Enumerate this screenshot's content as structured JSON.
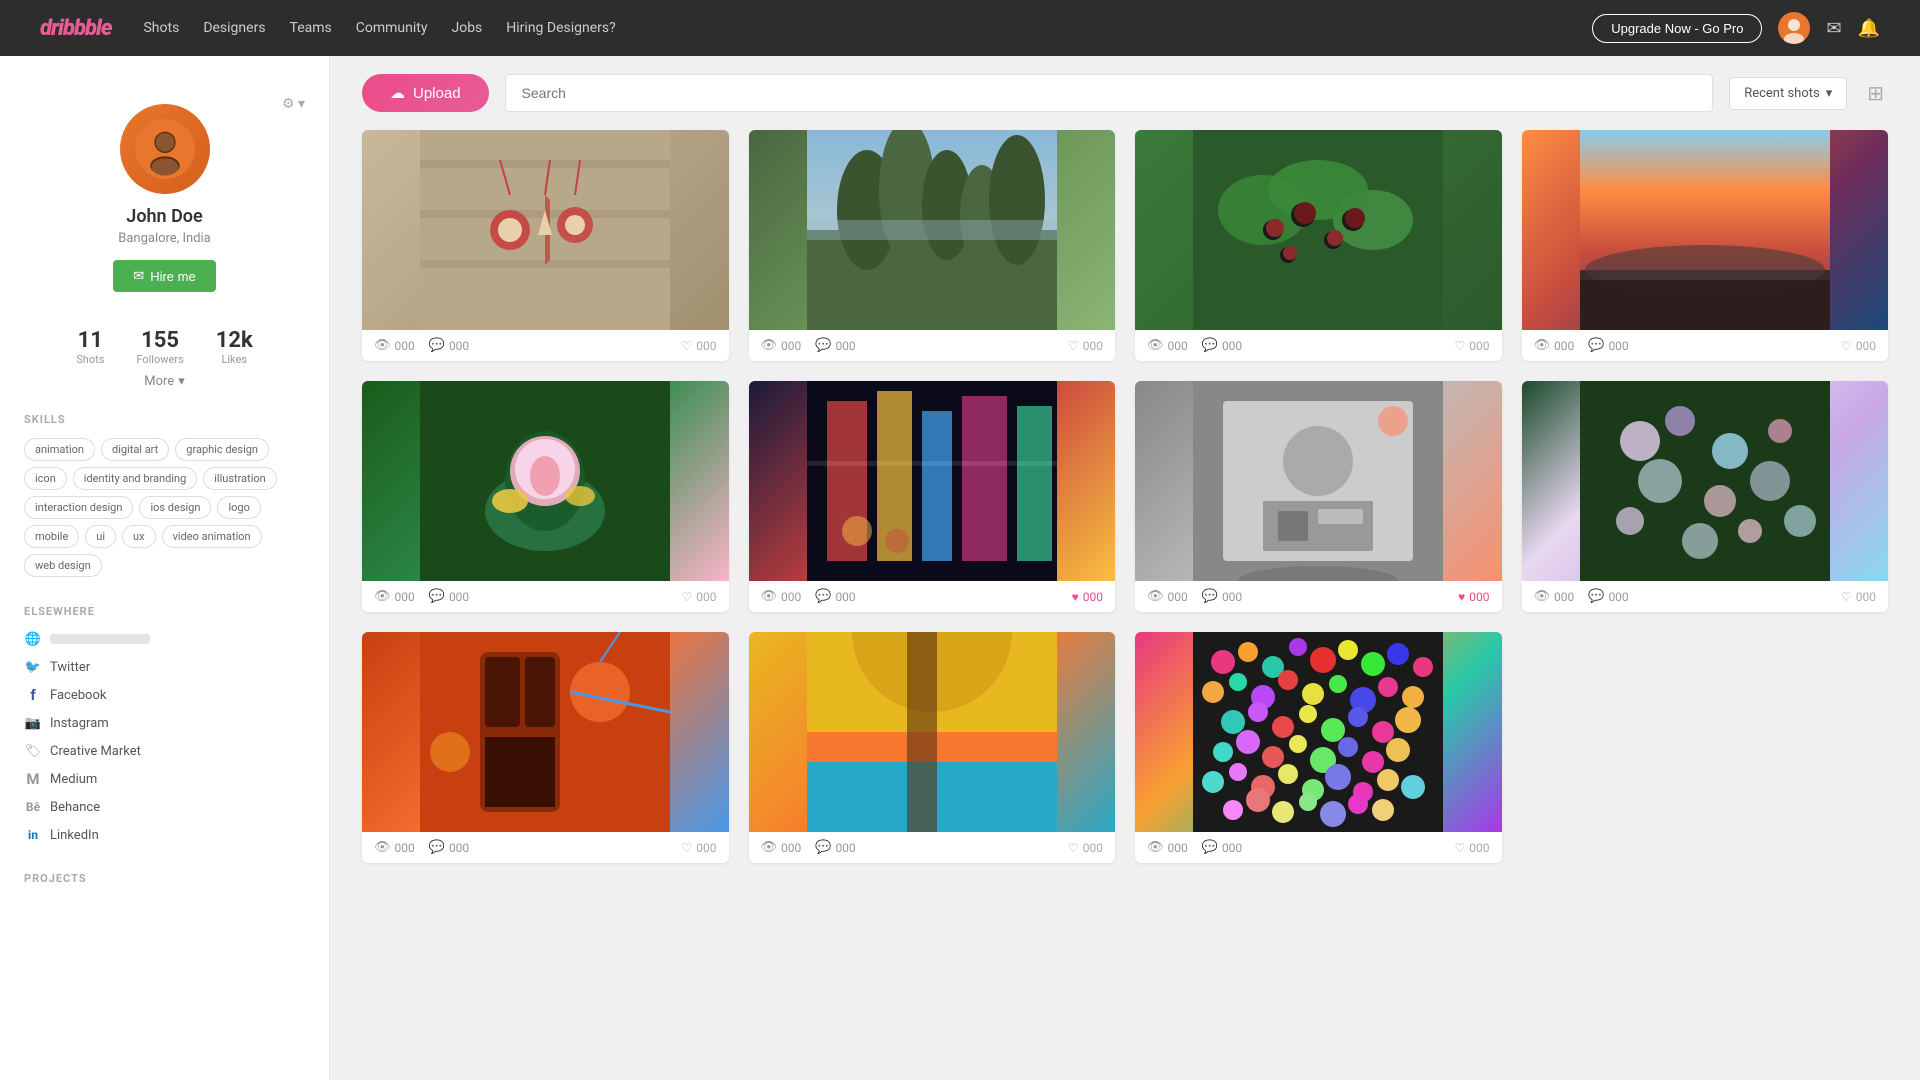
{
  "navbar": {
    "logo": "dribbble",
    "links": [
      {
        "label": "Shots",
        "id": "shots"
      },
      {
        "label": "Designers",
        "id": "designers"
      },
      {
        "label": "Teams",
        "id": "teams"
      },
      {
        "label": "Community",
        "id": "community"
      },
      {
        "label": "Jobs",
        "id": "jobs"
      },
      {
        "label": "Hiring Designers?",
        "id": "hiring"
      }
    ],
    "upgrade_button": "Upgrade Now - Go Pro",
    "mail_icon": "✉",
    "bell_icon": "🔔"
  },
  "toolbar": {
    "upload_label": "Upload",
    "search_placeholder": "Search",
    "recent_shots_label": "Recent shots",
    "grid_icon": "⊞"
  },
  "sidebar": {
    "profile": {
      "name": "John Doe",
      "location": "Bangalore, India",
      "hire_label": "Hire me"
    },
    "stats": {
      "shots_count": "11",
      "shots_label": "Shots",
      "followers_count": "155",
      "followers_label": "Followers",
      "likes_count": "12k",
      "likes_label": "Likes"
    },
    "more_label": "More",
    "skills_title": "SKILLS",
    "skills": [
      "animation",
      "digital art",
      "graphic design",
      "icon",
      "identity and branding",
      "illustration",
      "interaction design",
      "ios design",
      "logo",
      "mobile",
      "ui",
      "ux",
      "video animation",
      "web design"
    ],
    "elsewhere_title": "ELSEWHERE",
    "elsewhere_links": [
      {
        "label": "",
        "type": "url",
        "icon": "🌐"
      },
      {
        "label": "Twitter",
        "type": "twitter",
        "icon": "🐦"
      },
      {
        "label": "Facebook",
        "type": "facebook",
        "icon": "f"
      },
      {
        "label": "Instagram",
        "type": "instagram",
        "icon": "📷"
      },
      {
        "label": "Creative Market",
        "type": "creative_market",
        "icon": "🏷"
      },
      {
        "label": "Medium",
        "type": "medium",
        "icon": "M"
      },
      {
        "label": "Behance",
        "type": "behance",
        "icon": "Bē"
      },
      {
        "label": "LinkedIn",
        "type": "linkedin",
        "icon": "in"
      }
    ],
    "projects_title": "PROJECTS"
  },
  "shots": [
    {
      "id": 1,
      "views": "000",
      "comments": "000",
      "likes": "000",
      "heart": false,
      "row": 1
    },
    {
      "id": 2,
      "views": "000",
      "comments": "000",
      "likes": "000",
      "heart": false,
      "row": 1
    },
    {
      "id": 3,
      "views": "000",
      "comments": "000",
      "likes": "000",
      "heart": false,
      "row": 1
    },
    {
      "id": 4,
      "views": "000",
      "comments": "000",
      "likes": "000",
      "heart": false,
      "row": 1
    },
    {
      "id": 5,
      "views": "000",
      "comments": "000",
      "likes": "000",
      "heart": false,
      "row": 2
    },
    {
      "id": 6,
      "views": "000",
      "comments": "000",
      "likes": "000",
      "heart": true,
      "row": 2
    },
    {
      "id": 7,
      "views": "000",
      "comments": "000",
      "likes": "000",
      "heart": true,
      "row": 2
    },
    {
      "id": 8,
      "views": "000",
      "comments": "000",
      "likes": "000",
      "heart": false,
      "row": 2
    },
    {
      "id": 9,
      "views": "000",
      "comments": "000",
      "likes": "000",
      "heart": false,
      "row": 3
    },
    {
      "id": 10,
      "views": "000",
      "comments": "000",
      "likes": "000",
      "heart": false,
      "row": 3
    },
    {
      "id": 11,
      "views": "000",
      "comments": "000",
      "likes": "000",
      "heart": false,
      "row": 3
    }
  ]
}
